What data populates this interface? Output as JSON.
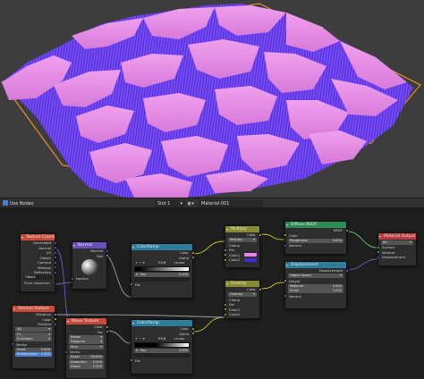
{
  "header": {
    "use_nodes_label": "Use Nodes",
    "slot_label": "Slot 1",
    "material_name": "Material.001"
  },
  "colors": {
    "terrain_light": "#e98ae8",
    "terrain_dark": "#6a3ff0",
    "selection_outline": "#e8902a",
    "node_texture_header": "#c84a3a",
    "node_vector_header": "#6b4fb8",
    "node_converter_header": "#2e7c9c",
    "node_color_header": "#8a8a2e",
    "node_shader_header": "#2e8a52",
    "node_output_header": "#b83a3a"
  },
  "nodes": {
    "texcoord": {
      "title": "Texture Coordinate",
      "outputs": [
        "Generated",
        "Normal",
        "UV",
        "Object",
        "Camera",
        "Window",
        "Reflection"
      ],
      "object_label": "Object",
      "from_instancer": "From Instancer"
    },
    "normal": {
      "title": "Normal",
      "outputs": [
        "Normal",
        "Dot"
      ],
      "input": "Normal"
    },
    "ramp1": {
      "title": "ColorRamp",
      "outputs": [
        "Color",
        "Alpha"
      ],
      "mode": "RGB",
      "interp": "Linear",
      "pos_label": "Pos",
      "pos_value": "0.105",
      "index": "0",
      "input": "Fac"
    },
    "multiply": {
      "title": "Multiply",
      "output": "Color",
      "blend": "Multiply",
      "clamp": "Clamp",
      "inputs": [
        "Fac",
        "Color1",
        "Color2"
      ]
    },
    "overlay": {
      "title": "Overlay",
      "output": "Color",
      "blend": "Overlay",
      "clamp": "Clamp",
      "inputs": [
        "Fac",
        "Color1",
        "Color2"
      ]
    },
    "diffuse": {
      "title": "Diffuse BSDF",
      "output": "BSDF",
      "inputs": [
        "Color",
        "Roughness",
        "Normal"
      ],
      "roughness_value": "0.000"
    },
    "displacement": {
      "title": "Displacement",
      "output": "Displacement",
      "space": "Object Space",
      "inputs": [
        "Height",
        "Midlevel",
        "Scale",
        "Normal"
      ],
      "midlevel_value": "0.500",
      "scale_value": "1.000"
    },
    "matout": {
      "title": "Material Output",
      "target": "All",
      "inputs": [
        "Surface",
        "Volume",
        "Displacement"
      ]
    },
    "voronoi": {
      "title": "Voronoi Texture",
      "outputs": [
        "Distance",
        "Color",
        "Position"
      ],
      "dims": "3D",
      "feature": "F1",
      "metric": "Euclidean",
      "input": "Vector",
      "scale_label": "Scale",
      "scale_value": "5.000",
      "random_label": "Randomness",
      "random_value": "1.000"
    },
    "wave": {
      "title": "Wave Texture",
      "outputs": [
        "Color",
        "Fac"
      ],
      "type": "Bands",
      "direction": "Diagonal",
      "profile": "Sine",
      "input": "Vector",
      "scale_label": "Scale",
      "scale_value": "40.000",
      "distortion_label": "Distortion",
      "distortion_value": "0.000",
      "detail_label": "Detail",
      "detail_value": "2.000"
    },
    "ramp2": {
      "title": "ColorRamp",
      "outputs": [
        "Color",
        "Alpha"
      ],
      "mode": "RGB",
      "interp": "Linear",
      "pos_label": "Pos",
      "pos_value": "0.395",
      "index": "0",
      "input": "Fac"
    }
  }
}
